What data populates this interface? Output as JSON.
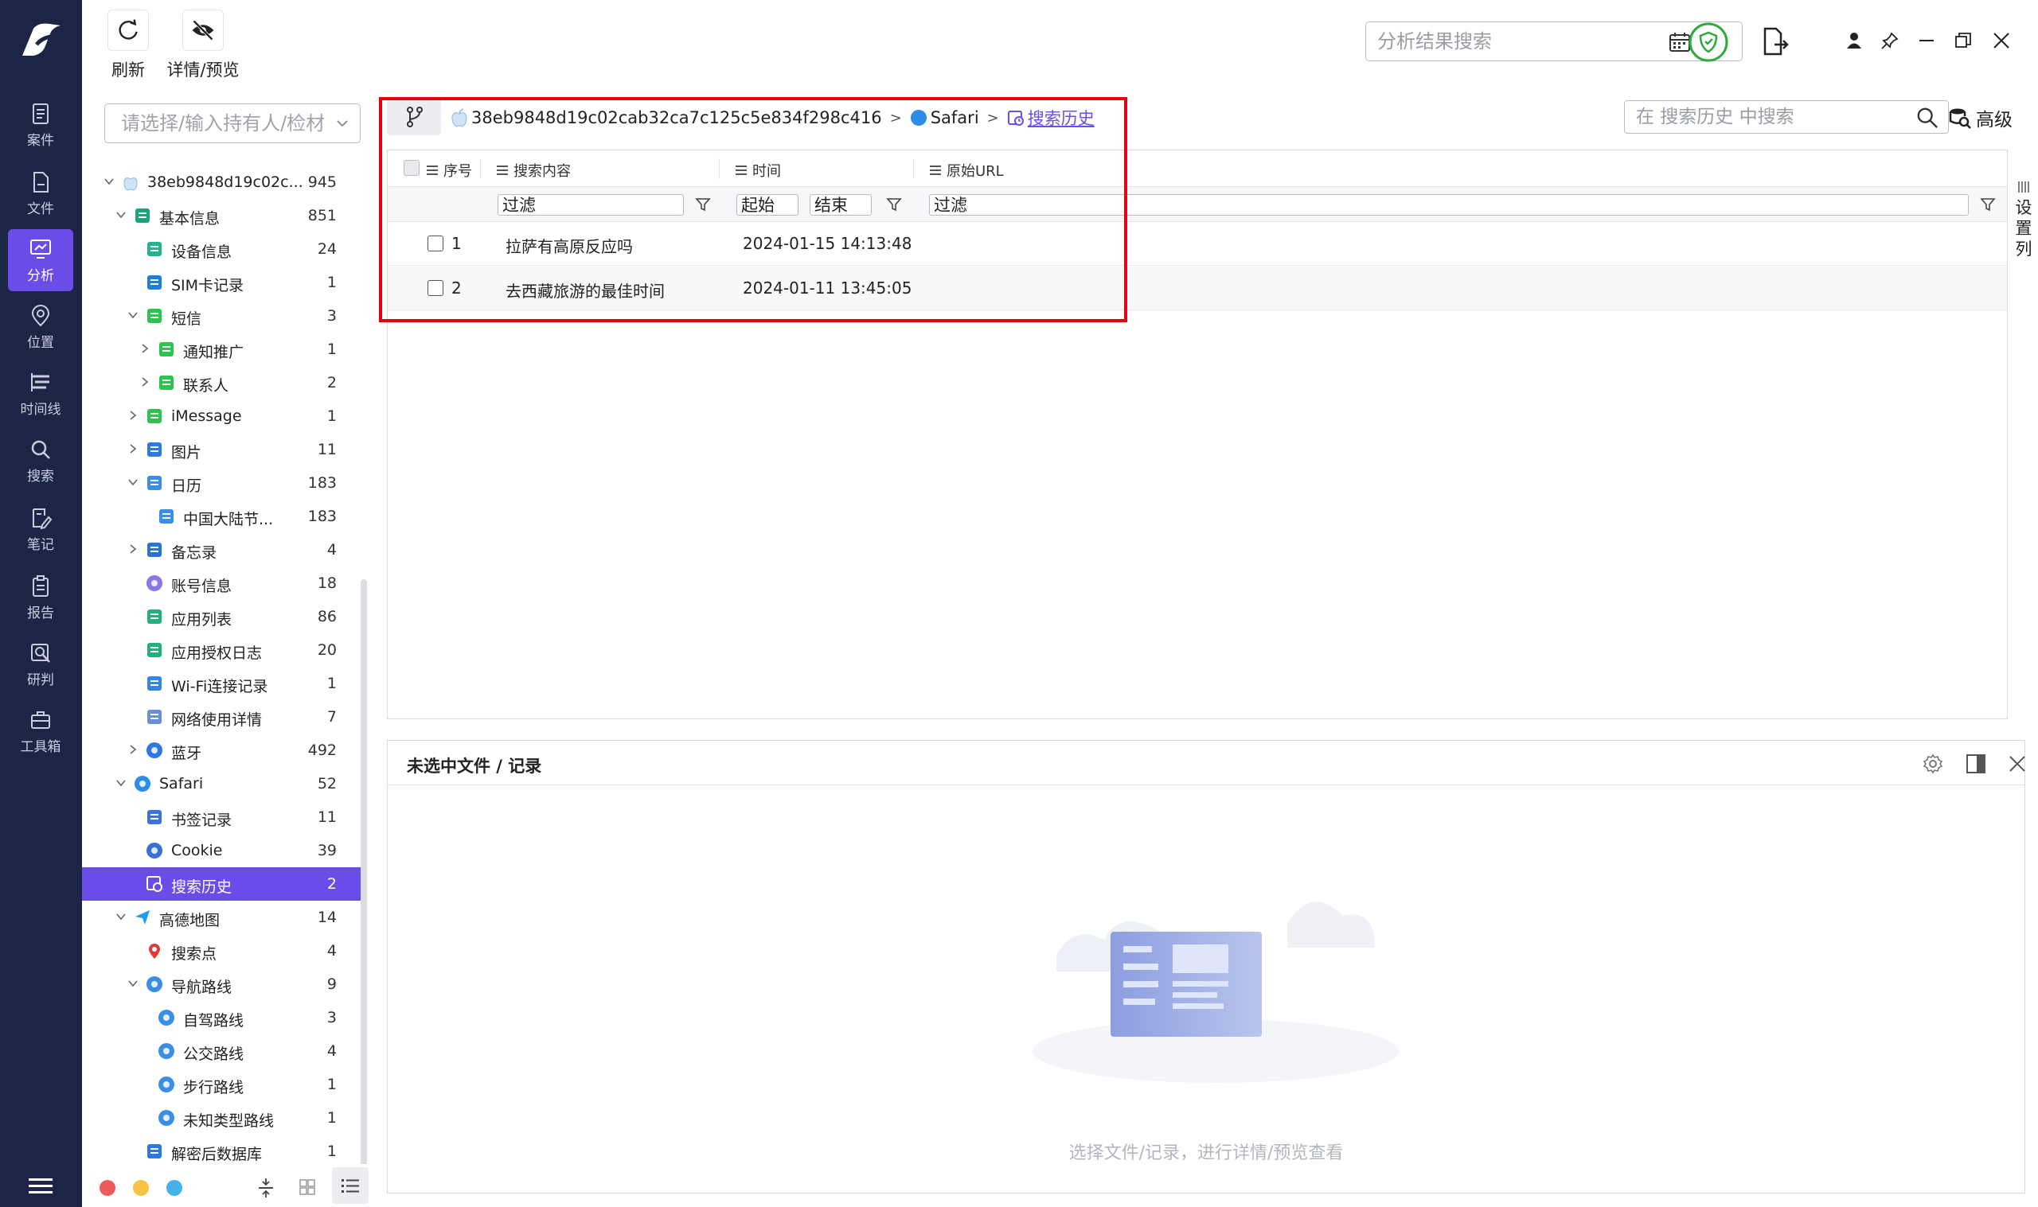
{
  "nav": {
    "items": [
      {
        "label": "案件",
        "icon": "case-icon"
      },
      {
        "label": "文件",
        "icon": "file-icon"
      },
      {
        "label": "分析",
        "icon": "analysis-icon",
        "active": true
      },
      {
        "label": "位置",
        "icon": "location-icon"
      },
      {
        "label": "时间线",
        "icon": "timeline-icon"
      },
      {
        "label": "搜索",
        "icon": "search-icon"
      },
      {
        "label": "笔记",
        "icon": "note-icon"
      },
      {
        "label": "报告",
        "icon": "report-icon"
      },
      {
        "label": "研判",
        "icon": "judge-icon"
      },
      {
        "label": "工具箱",
        "icon": "toolbox-icon"
      }
    ]
  },
  "toolbar": {
    "refresh_label": "刷新",
    "detail_label": "详情/预览",
    "search_placeholder": "分析结果搜索"
  },
  "tree": {
    "select_placeholder": "请选择/输入持有人/检材",
    "items": [
      {
        "label": "38eb9848d19c02c...",
        "count": "945",
        "icon": "apple-icon",
        "expanded": true
      },
      {
        "label": "基本信息",
        "count": "851",
        "icon": "basic-info-icon",
        "expanded": true
      },
      {
        "label": "设备信息",
        "count": "24",
        "icon": "device-info-icon"
      },
      {
        "label": "SIM卡记录",
        "count": "1",
        "icon": "sim-card-icon"
      },
      {
        "label": "短信",
        "count": "3",
        "icon": "sms-icon",
        "expanded": true
      },
      {
        "label": "通知推广",
        "count": "1",
        "icon": "sms-icon",
        "collapsed": true
      },
      {
        "label": "联系人",
        "count": "2",
        "icon": "sms-icon",
        "collapsed": true
      },
      {
        "label": "iMessage",
        "count": "1",
        "icon": "imessage-icon",
        "collapsed": true
      },
      {
        "label": "图片",
        "count": "11",
        "icon": "image-icon",
        "collapsed": true
      },
      {
        "label": "日历",
        "count": "183",
        "icon": "calendar-icon",
        "expanded": true
      },
      {
        "label": "中国大陆节...",
        "count": "183",
        "icon": "calendar-icon"
      },
      {
        "label": "备忘录",
        "count": "4",
        "icon": "memo-icon",
        "collapsed": true
      },
      {
        "label": "账号信息",
        "count": "18",
        "icon": "account-icon"
      },
      {
        "label": "应用列表",
        "count": "86",
        "icon": "app-list-icon"
      },
      {
        "label": "应用授权日志",
        "count": "20",
        "icon": "app-auth-icon"
      },
      {
        "label": "Wi-Fi连接记录",
        "count": "1",
        "icon": "wifi-icon"
      },
      {
        "label": "网络使用详情",
        "count": "7",
        "icon": "network-icon"
      },
      {
        "label": "蓝牙",
        "count": "492",
        "icon": "bluetooth-icon",
        "collapsed": true
      },
      {
        "label": "Safari",
        "count": "52",
        "icon": "safari-icon",
        "expanded": true
      },
      {
        "label": "书签记录",
        "count": "11",
        "icon": "bookmark-icon"
      },
      {
        "label": "Cookie",
        "count": "39",
        "icon": "cookie-icon"
      },
      {
        "label": "搜索历史",
        "count": "2",
        "icon": "search-history-icon",
        "selected": true
      },
      {
        "label": "高德地图",
        "count": "14",
        "icon": "amap-icon",
        "expanded": true
      },
      {
        "label": "搜索点",
        "count": "4",
        "icon": "pin-icon"
      },
      {
        "label": "导航路线",
        "count": "9",
        "icon": "route-icon",
        "expanded": true
      },
      {
        "label": "自驾路线",
        "count": "3",
        "icon": "route-icon"
      },
      {
        "label": "公交路线",
        "count": "4",
        "icon": "route-icon"
      },
      {
        "label": "步行路线",
        "count": "1",
        "icon": "route-icon"
      },
      {
        "label": "未知类型路线",
        "count": "1",
        "icon": "route-icon"
      },
      {
        "label": "解密后数据库",
        "count": "1",
        "icon": "database-icon"
      }
    ]
  },
  "breadcrumb": {
    "device": "38eb9848d19c02cab32ca7c125c5e834f298c416",
    "app": "Safari",
    "current": "搜索历史"
  },
  "inner_search": {
    "placeholder": "在 搜索历史 中搜索"
  },
  "advanced_label": "高级",
  "grid": {
    "columns": [
      "序号",
      "搜索内容",
      "时间",
      "原始URL"
    ],
    "filter_placeholder": "过滤",
    "start_placeholder": "起始",
    "end_placeholder": "结束",
    "rows": [
      {
        "index": "1",
        "content": "拉萨有高原反应吗",
        "time": "2024-01-15 14:13:48",
        "url": ""
      },
      {
        "index": "2",
        "content": "去西藏旅游的最佳时间",
        "time": "2024-01-11 13:45:05",
        "url": ""
      }
    ]
  },
  "set_columns_label": "设置列",
  "preview": {
    "title": "未选中文件 / 记录",
    "empty_text": "选择文件/记录，进行详情/预览查看"
  },
  "colors": {
    "nav_bg": "#1d2547",
    "accent": "#6a4de8",
    "highlight_box": "#e60012",
    "shield_green": "#2eaa3a"
  }
}
